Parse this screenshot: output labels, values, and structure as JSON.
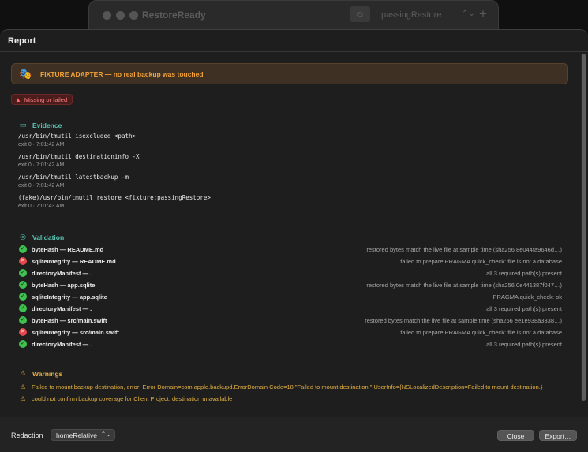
{
  "background_window": {
    "title": "RestoreReady",
    "scheme_icon": "masks-icon",
    "scheme_name": "passingRestore",
    "scheme_chevron": "⌃⌄",
    "add_symbol": "+"
  },
  "sheet": {
    "title": "Report"
  },
  "banner": {
    "icon": "theater-masks-icon",
    "icon_glyph": "🎭",
    "text": "FIXTURE ADAPTER — no real backup was touched",
    "color": "#f1a23a"
  },
  "status_badge": {
    "icon": "warning-triangle-icon",
    "icon_glyph": "▲",
    "label": "Missing or failed",
    "color": "#ff8080"
  },
  "evidence": {
    "title": "Evidence",
    "icon": "terminal-icon",
    "icon_glyph": "▭",
    "commands": [
      {
        "command": "/usr/bin/tmutil isexcluded <path>",
        "exit": "exit 0 · 7:01:42 AM"
      },
      {
        "command": "/usr/bin/tmutil destinationinfo -X",
        "exit": "exit 0 · 7:01:42 AM"
      },
      {
        "command": "/usr/bin/tmutil latestbackup -m",
        "exit": "exit 0 · 7:01:42 AM"
      },
      {
        "command": "(fake)/usr/bin/tmutil restore <fixture:passingRestore>",
        "exit": "exit 0 · 7:01:43 AM"
      }
    ]
  },
  "validation": {
    "title": "Validation",
    "icon": "checkmark-circle-icon",
    "icon_glyph": "◎",
    "rows": [
      {
        "status": "pass",
        "glyph": "✓",
        "name": "byteHash — README.md",
        "detail": "restored bytes match the live file at sample time (sha256 8e044fa9646d…)"
      },
      {
        "status": "fail",
        "glyph": "✕",
        "name": "sqliteIntegrity — README.md",
        "detail": "failed to prepare PRAGMA quick_check: file is not a database"
      },
      {
        "status": "pass",
        "glyph": "✓",
        "name": "directoryManifest — .",
        "detail": "all 3 required path(s) present"
      },
      {
        "status": "pass",
        "glyph": "✓",
        "name": "byteHash — app.sqlite",
        "detail": "restored bytes match the live file at sample time (sha256 0e441387f047…)"
      },
      {
        "status": "pass",
        "glyph": "✓",
        "name": "sqliteIntegrity — app.sqlite",
        "detail": "PRAGMA quick_check: ok"
      },
      {
        "status": "pass",
        "glyph": "✓",
        "name": "directoryManifest — .",
        "detail": "all 3 required path(s) present"
      },
      {
        "status": "pass",
        "glyph": "✓",
        "name": "byteHash — src/main.swift",
        "detail": "restored bytes match the live file at sample time (sha256 ee1e938a3338…)"
      },
      {
        "status": "fail",
        "glyph": "✕",
        "name": "sqliteIntegrity — src/main.swift",
        "detail": "failed to prepare PRAGMA quick_check: file is not a database"
      },
      {
        "status": "pass",
        "glyph": "✓",
        "name": "directoryManifest — .",
        "detail": "all 3 required path(s) present"
      }
    ]
  },
  "warnings": {
    "title": "Warnings",
    "icon": "warning-triangle-icon",
    "icon_glyph": "⚠",
    "items": [
      "Failed to mount backup destination, error: Error Domain=com.apple.backupd.ErrorDomain Code=18 \"Failed to mount destination.\" UserInfo={NSLocalizedDescription=Failed to mount destination.}",
      "could not confirm backup coverage for Client Project: destination unavailable"
    ]
  },
  "footer": {
    "redaction_label": "Redaction",
    "redaction_value": "homeRelative",
    "redaction_chevron": "⌃⌄",
    "close_label": "Close",
    "export_label": "Export…"
  },
  "colors": {
    "accent_teal": "#59c5b5",
    "warning_yellow": "#e4b140",
    "pass_green": "#3fc14f",
    "fail_red": "#e5484d"
  }
}
